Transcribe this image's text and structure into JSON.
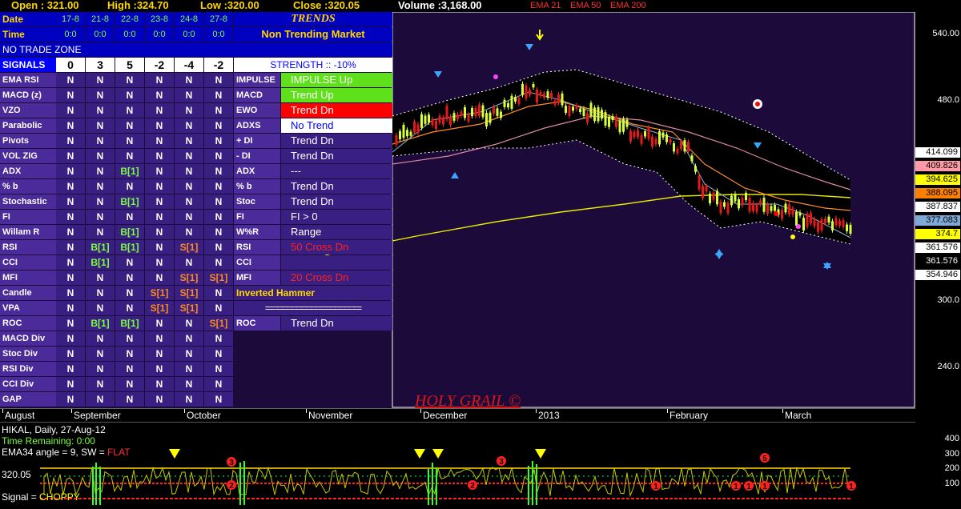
{
  "topbar": {
    "open": "Open : 321.00",
    "high": "High :324.70",
    "low": "Low :320.00",
    "close": "Close :320.05",
    "volume": "Volume :3,168.00",
    "ema21": "EMA 21",
    "ema50": "EMA 50",
    "ema200": "EMA 200"
  },
  "header": {
    "date_label": "Date",
    "time_label": "Time",
    "dates": [
      "17-8",
      "21-8",
      "22-8",
      "23-8",
      "24-8",
      "27-8"
    ],
    "times": [
      "0:0",
      "0:0",
      "0:0",
      "0:0",
      "0:0",
      "0:0"
    ],
    "trends_title": "TRENDS",
    "trends_sub": "Non Trending Market",
    "no_trade": "NO TRADE ZONE",
    "signals_label": "SIGNALS",
    "signals": [
      "0",
      "3",
      "5",
      "-2",
      "-4",
      "-2"
    ],
    "strength": "STRENGTH :: -10%"
  },
  "rows": [
    {
      "label": "EMA RSI",
      "vals": [
        "N",
        "N",
        "N",
        "N",
        "N",
        "N"
      ]
    },
    {
      "label": "MACD (z)",
      "vals": [
        "N",
        "N",
        "N",
        "N",
        "N",
        "N"
      ]
    },
    {
      "label": "VZO",
      "vals": [
        "N",
        "N",
        "N",
        "N",
        "N",
        "N"
      ]
    },
    {
      "label": "Parabolic",
      "vals": [
        "N",
        "N",
        "N",
        "N",
        "N",
        "N"
      ]
    },
    {
      "label": "Pivots",
      "vals": [
        "N",
        "N",
        "N",
        "N",
        "N",
        "N"
      ]
    },
    {
      "label": "VOL ZIG",
      "vals": [
        "N",
        "N",
        "N",
        "N",
        "N",
        "N"
      ]
    },
    {
      "label": "ADX",
      "vals": [
        "N",
        "N",
        "B[1]",
        "N",
        "N",
        "N"
      ]
    },
    {
      "label": "% b",
      "vals": [
        "N",
        "N",
        "N",
        "N",
        "N",
        "N"
      ]
    },
    {
      "label": "Stochastic",
      "vals": [
        "N",
        "N",
        "B[1]",
        "N",
        "N",
        "N"
      ]
    },
    {
      "label": "FI",
      "vals": [
        "N",
        "N",
        "N",
        "N",
        "N",
        "N"
      ]
    },
    {
      "label": "Willam R",
      "vals": [
        "N",
        "N",
        "B[1]",
        "N",
        "N",
        "N"
      ]
    },
    {
      "label": "RSI",
      "vals": [
        "N",
        "B[1]",
        "B[1]",
        "N",
        "S[1]",
        "N"
      ]
    },
    {
      "label": "CCI",
      "vals": [
        "N",
        "B[1]",
        "N",
        "N",
        "N",
        "N"
      ]
    },
    {
      "label": "MFI",
      "vals": [
        "N",
        "N",
        "N",
        "N",
        "S[1]",
        "S[1]"
      ]
    },
    {
      "label": "Candle",
      "vals": [
        "N",
        "N",
        "N",
        "S[1]",
        "S[1]",
        "N"
      ]
    },
    {
      "label": "VPA",
      "vals": [
        "N",
        "N",
        "N",
        "S[1]",
        "S[1]",
        "N"
      ]
    },
    {
      "label": "ROC",
      "vals": [
        "N",
        "B[1]",
        "B[1]",
        "N",
        "N",
        "S[1]"
      ]
    },
    {
      "label": "MACD Div",
      "vals": [
        "N",
        "N",
        "N",
        "N",
        "N",
        "N"
      ]
    },
    {
      "label": "Stoc Div",
      "vals": [
        "N",
        "N",
        "N",
        "N",
        "N",
        "N"
      ]
    },
    {
      "label": "RSI Div",
      "vals": [
        "N",
        "N",
        "N",
        "N",
        "N",
        "N"
      ]
    },
    {
      "label": "CCI Div",
      "vals": [
        "N",
        "N",
        "N",
        "N",
        "N",
        "N"
      ]
    },
    {
      "label": "GAP",
      "vals": [
        "N",
        "N",
        "N",
        "N",
        "N",
        "N"
      ]
    }
  ],
  "trends": [
    {
      "label": "IMPULSE",
      "value": "IMPULSE Up",
      "bg": "#5ee01a",
      "fg": "#ffffff"
    },
    {
      "label": "MACD",
      "value": "Trend Up",
      "bg": "#5ee01a",
      "fg": "#ffffff"
    },
    {
      "label": "EWO",
      "value": "Trend Dn",
      "bg": "#ff0000",
      "fg": "#ffffff"
    },
    {
      "label": "ADXS",
      "value": "No Trend",
      "bg": "#ffffff",
      "fg": "#0000ff"
    },
    {
      "label": "+ DI",
      "value": "Trend Dn",
      "bg": "#3a1f82",
      "fg": "#ffffff"
    },
    {
      "label": "- DI",
      "value": "Trend Dn",
      "bg": "#3a1f82",
      "fg": "#ffffff"
    },
    {
      "label": "ADX",
      "value": "---",
      "bg": "#3a1f82",
      "fg": "#ffffff"
    },
    {
      "label": "% b",
      "value": "Trend Dn",
      "bg": "#3a1f82",
      "fg": "#ffffff"
    },
    {
      "label": "Stoc",
      "value": "Trend Dn",
      "bg": "#3a1f82",
      "fg": "#ffffff"
    },
    {
      "label": "FI",
      "value": "FI > 0",
      "bg": "#3a1f82",
      "fg": "#ffffff"
    },
    {
      "label": "W%R",
      "value": "Range",
      "bg": "#3a1f82",
      "fg": "#ffffff"
    },
    {
      "label": "RSI",
      "value": "50 Cross Dn",
      "bg": "#3a1f82",
      "fg": "#ff2020"
    },
    {
      "label": "CCI",
      "value": "",
      "bg": "#3a1f82",
      "fg": "#ffffff"
    },
    {
      "label": "MFI",
      "value": "20 Cross Dn",
      "bg": "#3a1f82",
      "fg": "#ff2020"
    }
  ],
  "candle_pattern": "Inverted Hammer",
  "separator": "====================",
  "roc": {
    "label": "ROC",
    "value": "Trend Dn"
  },
  "watermark": "HOLY GRAIL ©",
  "price_axis": {
    "ticks": [
      "540.00",
      "480.0",
      "300.0",
      "240.0"
    ],
    "boxes": [
      {
        "text": "414.099",
        "bg": "#ffffff",
        "fg": "#000000"
      },
      {
        "text": "409.826",
        "bg": "#ff9aa6",
        "fg": "#000000"
      },
      {
        "text": "394.625",
        "bg": "#ffff00",
        "fg": "#000000"
      },
      {
        "text": "388.095",
        "bg": "#ff7f00",
        "fg": "#000000"
      },
      {
        "text": "387.837",
        "bg": "#ffffff",
        "fg": "#000000"
      },
      {
        "text": "377.083",
        "bg": "#7fa9d6",
        "fg": "#000000"
      },
      {
        "text": "374.7",
        "bg": "#ffff00",
        "fg": "#000000"
      },
      {
        "text": "361.576",
        "bg": "#ffffff",
        "fg": "#000000"
      },
      {
        "text": "361.576",
        "bg": "#000000",
        "fg": "#ffffff"
      },
      {
        "text": "354.946",
        "bg": "#ffffff",
        "fg": "#000000"
      }
    ]
  },
  "time_axis": [
    "August",
    "September",
    "October",
    "November",
    "December",
    "2013",
    "February",
    "March"
  ],
  "indicator": {
    "symbol": "HIKAL, Daily, 27-Aug-12",
    "time_remaining": "Time Remaining: 0:00",
    "ema_prefix": "EMA34 angle = 9, SW = ",
    "ema_state": "FLAT",
    "price": "320.05",
    "signal_prefix": "Signal = ",
    "signal_state": "CHOPPY",
    "axis": [
      "400",
      "300",
      "200",
      "100"
    ]
  },
  "colors": {
    "grid_bg": "#3a1f82",
    "label_bg": "#4b2a9a",
    "header_bg": "#0000c0",
    "buy": "#7dff40",
    "sell": "#ff8c1a",
    "chart_bg": "#1b0a3a"
  }
}
